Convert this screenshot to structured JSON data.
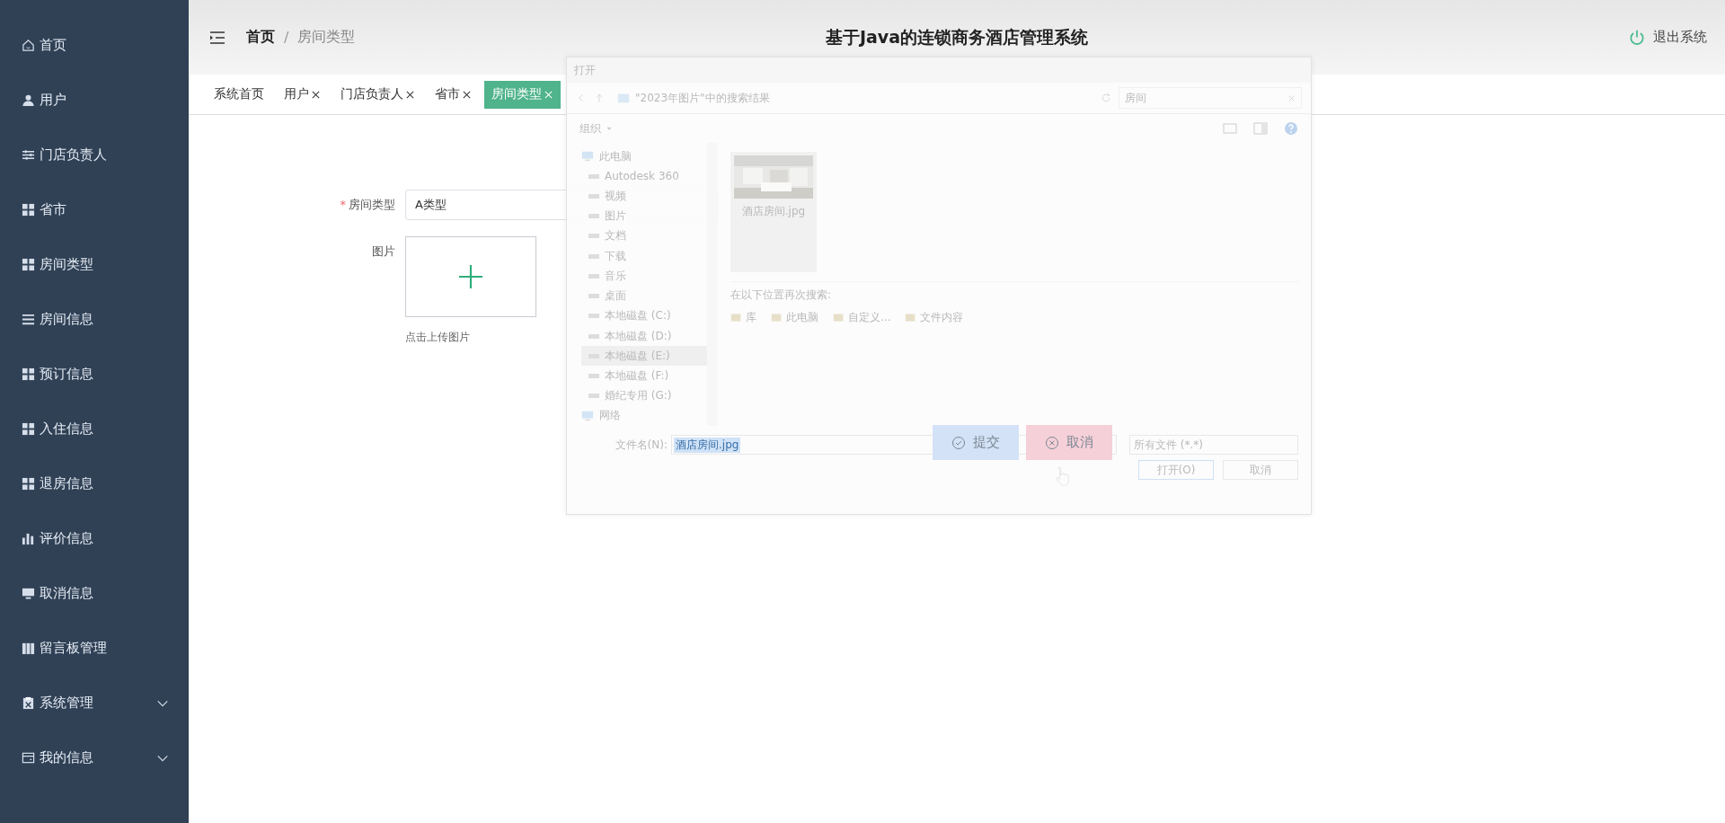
{
  "sidebar": {
    "items": [
      {
        "label": "首页",
        "kind": "link"
      },
      {
        "label": "用户",
        "kind": "link"
      },
      {
        "label": "门店负责人",
        "kind": "link"
      },
      {
        "label": "省市",
        "kind": "link"
      },
      {
        "label": "房间类型",
        "kind": "link"
      },
      {
        "label": "房间信息",
        "kind": "link"
      },
      {
        "label": "预订信息",
        "kind": "link"
      },
      {
        "label": "入住信息",
        "kind": "link"
      },
      {
        "label": "退房信息",
        "kind": "link"
      },
      {
        "label": "评价信息",
        "kind": "link"
      },
      {
        "label": "取消信息",
        "kind": "link"
      },
      {
        "label": "留言板管理",
        "kind": "link"
      },
      {
        "label": "系统管理",
        "kind": "submenu"
      },
      {
        "label": "我的信息",
        "kind": "submenu"
      }
    ]
  },
  "header": {
    "breadcrumb": [
      "首页",
      "房间类型"
    ],
    "separator": "/",
    "title": "基于Java的连锁商务酒店管理系统",
    "logout": "退出系统"
  },
  "tabs": [
    {
      "label": "系统首页",
      "selected": false,
      "closable": false
    },
    {
      "label": "用户",
      "selected": false,
      "closable": true
    },
    {
      "label": "门店负责人",
      "selected": false,
      "closable": true
    },
    {
      "label": "省市",
      "selected": false,
      "closable": true
    },
    {
      "label": "房间类型",
      "selected": true,
      "closable": true
    }
  ],
  "form": {
    "fields": [
      {
        "kind": "text",
        "label": "房间类型",
        "required_mark": "*",
        "value": "A类型"
      },
      {
        "kind": "upload",
        "label": "图片",
        "hint": "点击上传图片"
      }
    ],
    "buttons": [
      {
        "label": "提交",
        "kind": "submit"
      },
      {
        "label": "取消",
        "kind": "cancel"
      }
    ]
  },
  "file_dialog": {
    "title": "打开",
    "address": "\"2023年图片\"中的搜索结果",
    "search": "房间",
    "organize": "组织",
    "nav": [
      {
        "label": "此电脑",
        "selected": false,
        "children": [
          {
            "label": "Autodesk 360",
            "selected": false
          },
          {
            "label": "视频",
            "selected": false
          },
          {
            "label": "图片",
            "selected": false
          },
          {
            "label": "文档",
            "selected": false
          },
          {
            "label": "下载",
            "selected": false
          },
          {
            "label": "音乐",
            "selected": false
          },
          {
            "label": "桌面",
            "selected": false
          },
          {
            "label": "本地磁盘 (C:)",
            "selected": false
          },
          {
            "label": "本地磁盘 (D:)",
            "selected": false
          },
          {
            "label": "本地磁盘 (E:)",
            "selected": true
          },
          {
            "label": "本地磁盘 (F:)",
            "selected": false
          },
          {
            "label": "婚纪专用 (G:)",
            "selected": false
          }
        ]
      },
      {
        "label": "网络",
        "selected": false
      }
    ],
    "files": [
      {
        "name": "酒店房间.jpg",
        "kind": "picture"
      }
    ],
    "search_again": {
      "label": "在以下位置再次搜索:",
      "links": [
        "库",
        "此电脑",
        "自定义...",
        "文件内容"
      ]
    },
    "filename_label": "文件名(N):",
    "filename": "酒店房间.jpg",
    "filetype": "所有文件 (*.*)",
    "buttons": [
      "打开(O)",
      "取消"
    ]
  }
}
